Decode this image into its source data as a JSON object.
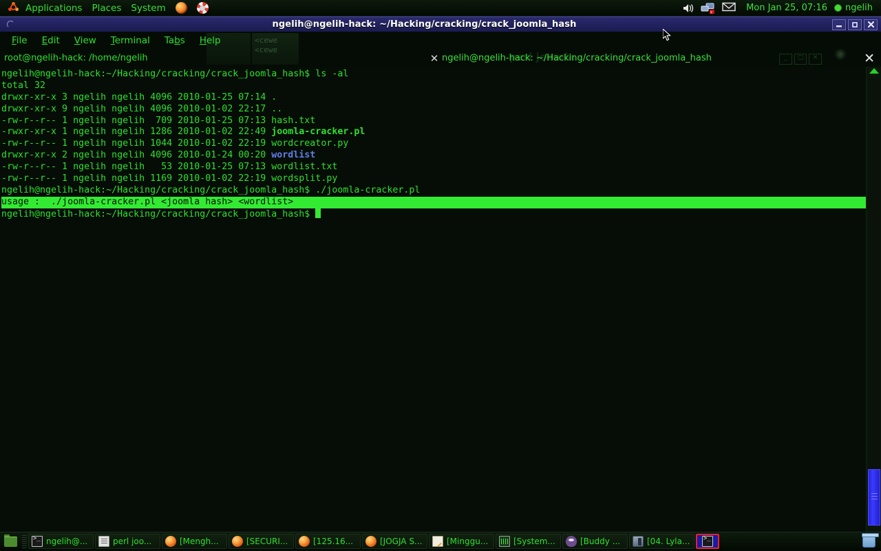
{
  "top_panel": {
    "menus": [
      {
        "label": "Applications",
        "icon": "ubuntu-logo-icon"
      },
      {
        "label": "Places",
        "icon": null
      },
      {
        "label": "System",
        "icon": null
      }
    ],
    "launchers": [
      {
        "name": "firefox-launcher",
        "icon": "firefox-icon"
      },
      {
        "name": "help-launcher",
        "icon": "lifering-icon"
      }
    ],
    "tray": [
      {
        "name": "volume-icon",
        "icon": "speaker-icon"
      },
      {
        "name": "network-icon",
        "icon": "network-disconnected-icon"
      },
      {
        "name": "mail-icon",
        "icon": "envelope-icon"
      }
    ],
    "clock": "Mon Jan 25, 07:16",
    "user": "ngelih",
    "user_status": "available",
    "accent_green": "#2ee02e"
  },
  "window": {
    "title": "ngelih@ngelih-hack: ~/Hacking/cracking/crack_joomla_hash",
    "titlebar_color": "#232360",
    "buttons": [
      {
        "name": "minimize-button",
        "glyph": "▃"
      },
      {
        "name": "maximize-button",
        "glyph": "□"
      },
      {
        "name": "close-button",
        "glyph": "✕"
      }
    ]
  },
  "menubar": {
    "items": [
      {
        "label": "File",
        "mnemonic": "F"
      },
      {
        "label": "Edit",
        "mnemonic": "E"
      },
      {
        "label": "View",
        "mnemonic": "V"
      },
      {
        "label": "Terminal",
        "mnemonic": "T"
      },
      {
        "label": "Tabs",
        "mnemonic": "b"
      },
      {
        "label": "Help",
        "mnemonic": "H"
      }
    ]
  },
  "tabs": {
    "items": [
      {
        "label": "root@ngelih-hack: /home/ngelih",
        "active": false
      },
      {
        "label": "ngelih@ngelih-hack: ~/Hacking/cracking/crack_joomla_hash",
        "active": true
      }
    ],
    "close_glyph": "✕",
    "tabbar_close_glyph": "✕"
  },
  "terminal": {
    "prompt": "ngelih@ngelih-hack:~/Hacking/cracking/crack_joomla_hash$",
    "lines": [
      {
        "text": "ngelih@ngelih-hack:~/Hacking/cracking/crack_joomla_hash$ ls -al"
      },
      {
        "text": "total 32"
      },
      {
        "text": "drwxr-xr-x 3 ngelih ngelih 4096 2010-01-25 07:14 ."
      },
      {
        "text": "drwxr-xr-x 9 ngelih ngelih 4096 2010-01-02 22:17 .."
      },
      {
        "text": "-rw-r--r-- 1 ngelih ngelih  709 2010-01-25 07:13 hash.txt"
      },
      {
        "text": "-rwxr-xr-x 1 ngelih ngelih 1286 2010-01-02 22:49 ",
        "bold_name": "joomla-cracker.pl",
        "bold_kind": "exec"
      },
      {
        "text": "-rw-r--r-- 1 ngelih ngelih 1044 2010-01-02 22:19 wordcreator.py"
      },
      {
        "text": "drwxr-xr-x 2 ngelih ngelih 4096 2010-01-24 00:20 ",
        "bold_name": "wordlist",
        "bold_kind": "dir"
      },
      {
        "text": "-rw-r--r-- 1 ngelih ngelih   53 2010-01-25 07:13 wordlist.txt"
      },
      {
        "text": "-rw-r--r-- 1 ngelih ngelih 1169 2010-01-02 22:19 wordsplit.py"
      },
      {
        "text": "ngelih@ngelih-hack:~/Hacking/cracking/crack_joomla_hash$ ./joomla-cracker.pl"
      },
      {
        "text": "usage :  ./joomla-cracker.pl <joomla hash> <wordlist>",
        "highlight": true
      },
      {
        "text": "ngelih@ngelih-hack:~/Hacking/cracking/crack_joomla_hash$ ",
        "cursor": true
      }
    ],
    "fg_color": "#2ee02e",
    "bg_color": "#060d06",
    "highlight_bg": "#33ea33",
    "highlight_fg": "#061006",
    "dir_color": "#5f7fe8"
  },
  "scrollbar": {
    "name": "terminal-scrollbar",
    "up_arrow": "▲",
    "thumb_color": "#3a3aff"
  },
  "taskbar": {
    "show_desktop": "show-desktop-button",
    "tasks": [
      {
        "label": "ngelih@...",
        "icon": "terminal-icon",
        "active": false
      },
      {
        "label": "perl joo...",
        "icon": "document-icon",
        "active": false
      },
      {
        "label": "[Mengh...",
        "icon": "firefox-icon",
        "active": false
      },
      {
        "label": "[SECURI...",
        "icon": "firefox-icon",
        "active": false
      },
      {
        "label": "[125.16...",
        "icon": "firefox-icon",
        "active": false
      },
      {
        "label": "[JOGJA S...",
        "icon": "firefox-icon",
        "active": false
      },
      {
        "label": "[Minggu...",
        "icon": "notepad-icon",
        "active": false
      },
      {
        "label": "[System...",
        "icon": "system-monitor-icon",
        "active": false
      },
      {
        "label": "[Buddy ...",
        "icon": "pidgin-icon",
        "active": false
      },
      {
        "label": "[04. Lyla...",
        "icon": "media-player-icon",
        "active": false
      },
      {
        "label": "",
        "icon": "terminal-icon",
        "active": true
      }
    ],
    "trash": "trash-icon",
    "active_border_color": "#ee2222",
    "active_bg_color": "#1a1aa8"
  }
}
